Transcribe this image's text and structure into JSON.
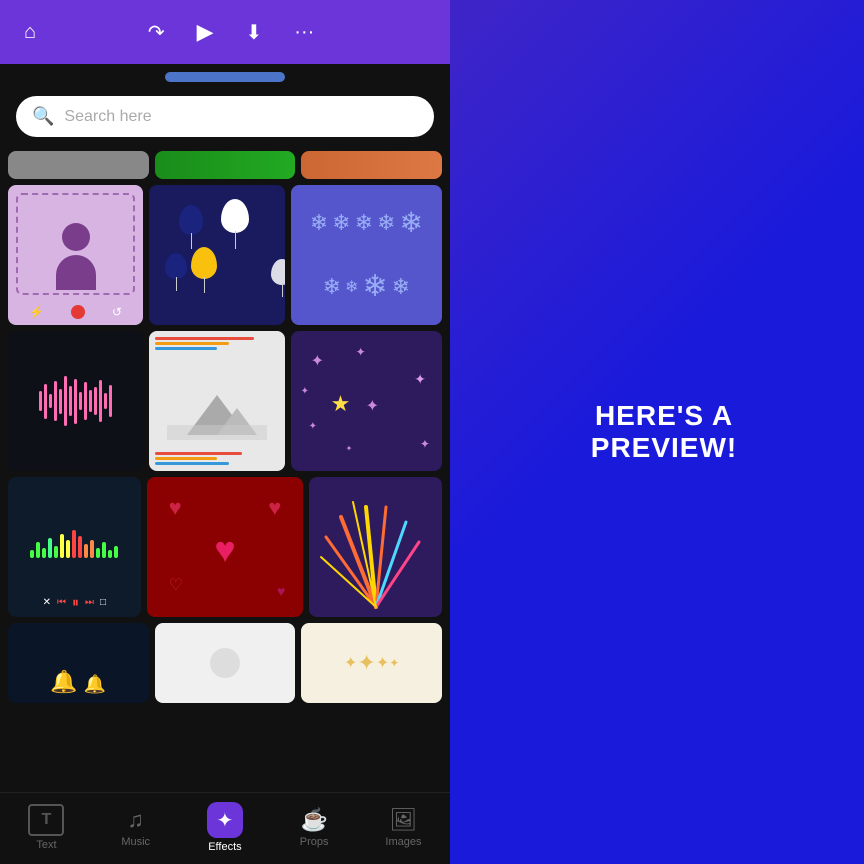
{
  "toolbar": {
    "home_icon": "⌂",
    "redo_icon": "↷",
    "play_icon": "▶",
    "download_icon": "⬇",
    "more_icon": "···"
  },
  "search": {
    "placeholder": "Search here"
  },
  "preview_text": "HERE'S A PREVIEW!",
  "grid": {
    "partial_row": [
      "gray",
      "green",
      "orange"
    ],
    "rows": [
      [
        "purple-person",
        "balloons",
        "snowflakes"
      ],
      [
        "soundwave",
        "landscape",
        "stars"
      ],
      [
        "music-player",
        "hearts",
        "fireworks"
      ],
      [
        "dark-bells",
        "light",
        "sparkles"
      ]
    ]
  },
  "bottom_nav": {
    "items": [
      {
        "icon": "T",
        "label": "Text",
        "active": false
      },
      {
        "icon": "♫",
        "label": "Music",
        "active": false
      },
      {
        "icon": "✦",
        "label": "Effects",
        "active": true
      },
      {
        "icon": "☕",
        "label": "Props",
        "active": false
      },
      {
        "icon": "🖼",
        "label": "Images",
        "active": false
      }
    ]
  }
}
